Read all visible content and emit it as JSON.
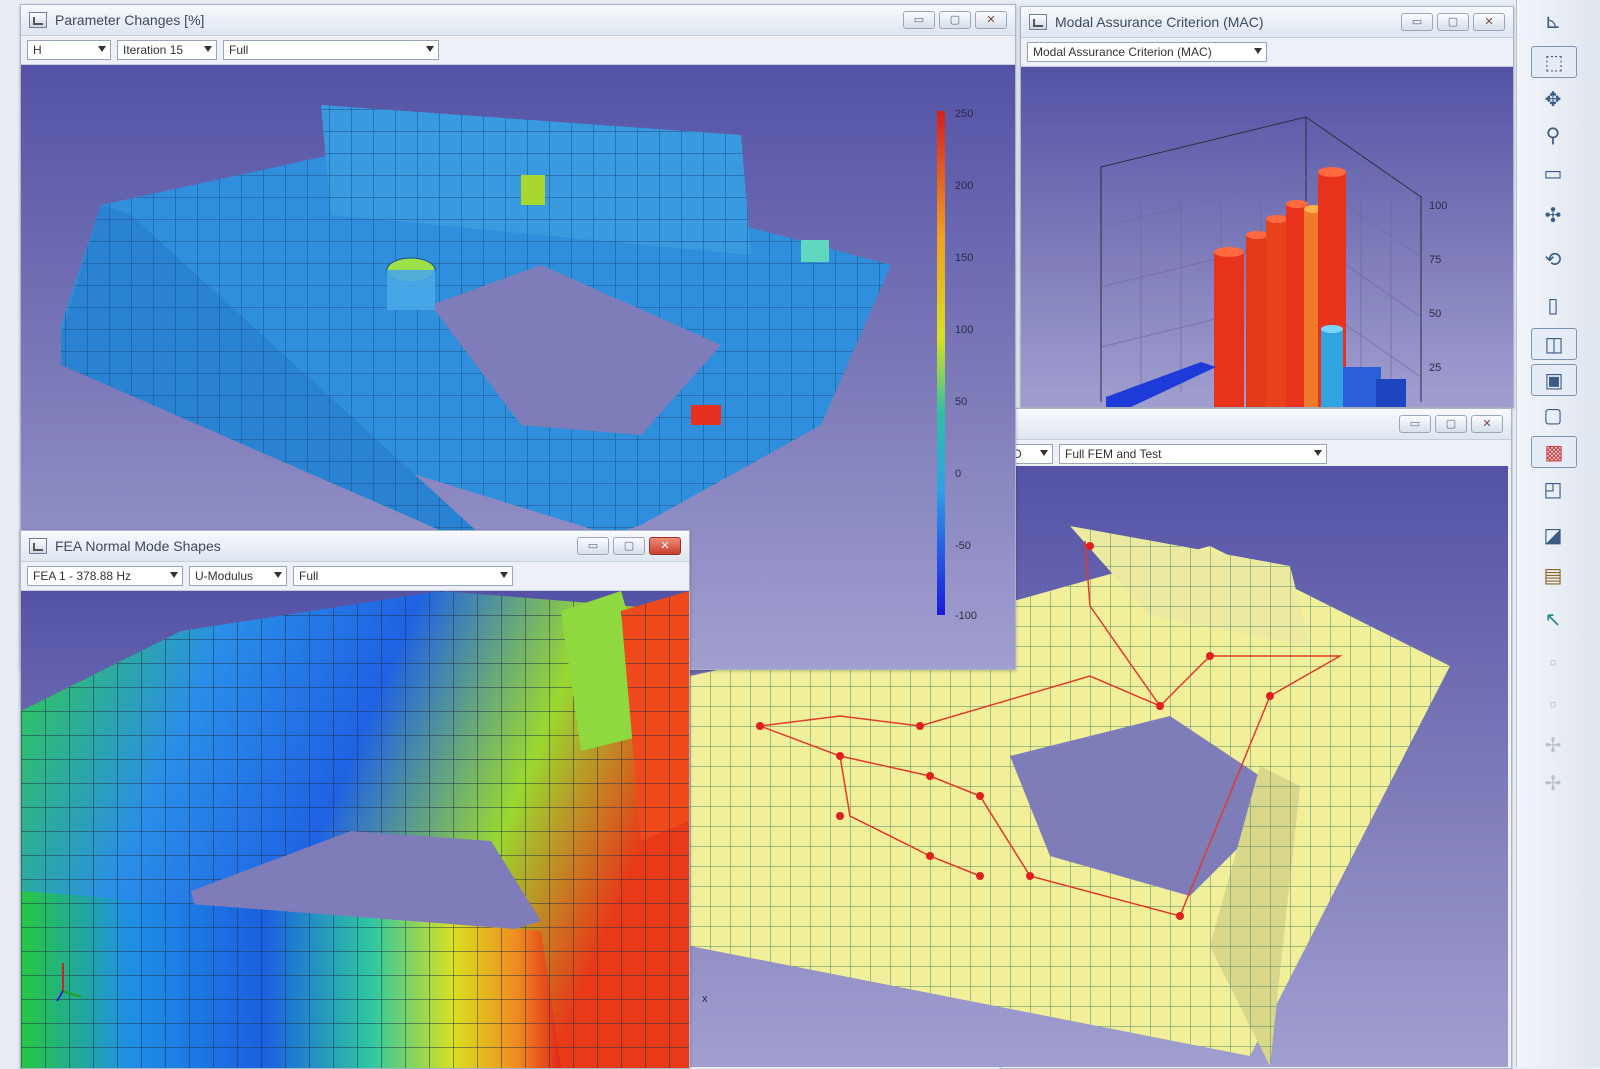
{
  "windows": {
    "param": {
      "title": "Parameter Changes [%]",
      "dropdowns": [
        "H",
        "Iteration 15",
        "Full"
      ],
      "colorbar_ticks": [
        "250",
        "200",
        "150",
        "100",
        "50",
        "0",
        "-50",
        "-100"
      ],
      "buttons": [
        "▭",
        "▢",
        "✕"
      ]
    },
    "mac": {
      "title": "Modal Assurance Criterion (MAC)",
      "dropdowns": [
        "Modal Assurance Criterion (MAC)"
      ],
      "axis_ticks": [
        "100",
        "75",
        "50",
        "25"
      ],
      "buttons": [
        "▭",
        "▢",
        "✕"
      ]
    },
    "fem": {
      "dropdowns": [
        "D",
        "Full FEM and Test"
      ],
      "buttons": [
        "▭",
        "▢",
        "✕"
      ],
      "axis_label": "x"
    },
    "fea": {
      "title": "FEA Normal Mode Shapes",
      "dropdowns": [
        "FEA 1 - 378.88 Hz",
        "U-Modulus",
        "Full"
      ],
      "buttons": [
        "▭",
        "▢",
        "✕"
      ]
    }
  },
  "toolbar_icons": [
    "axes-icon",
    "pick-icon",
    "move-icon",
    "zoom-icon",
    "zoom-box-icon",
    "rotate-icon",
    "spin-icon",
    "page-icon",
    "wire-box-icon",
    "solid-box-icon",
    "transparent-box-icon",
    "color-box-icon",
    "small-box-icon",
    "mesh-icon",
    "film-icon",
    "cursor-icon",
    "disabled-icon-1",
    "disabled-icon-2",
    "disabled-icon-3",
    "disabled-icon-4"
  ],
  "colors": {
    "mesh_blue": "#2f8fdc",
    "mesh_yellow": "#f1ef9a",
    "bar_red": "#e8321c",
    "bar_blue": "#2a5fd8",
    "viewport_top": "#5452a6",
    "viewport_bottom": "#a19fd0"
  }
}
